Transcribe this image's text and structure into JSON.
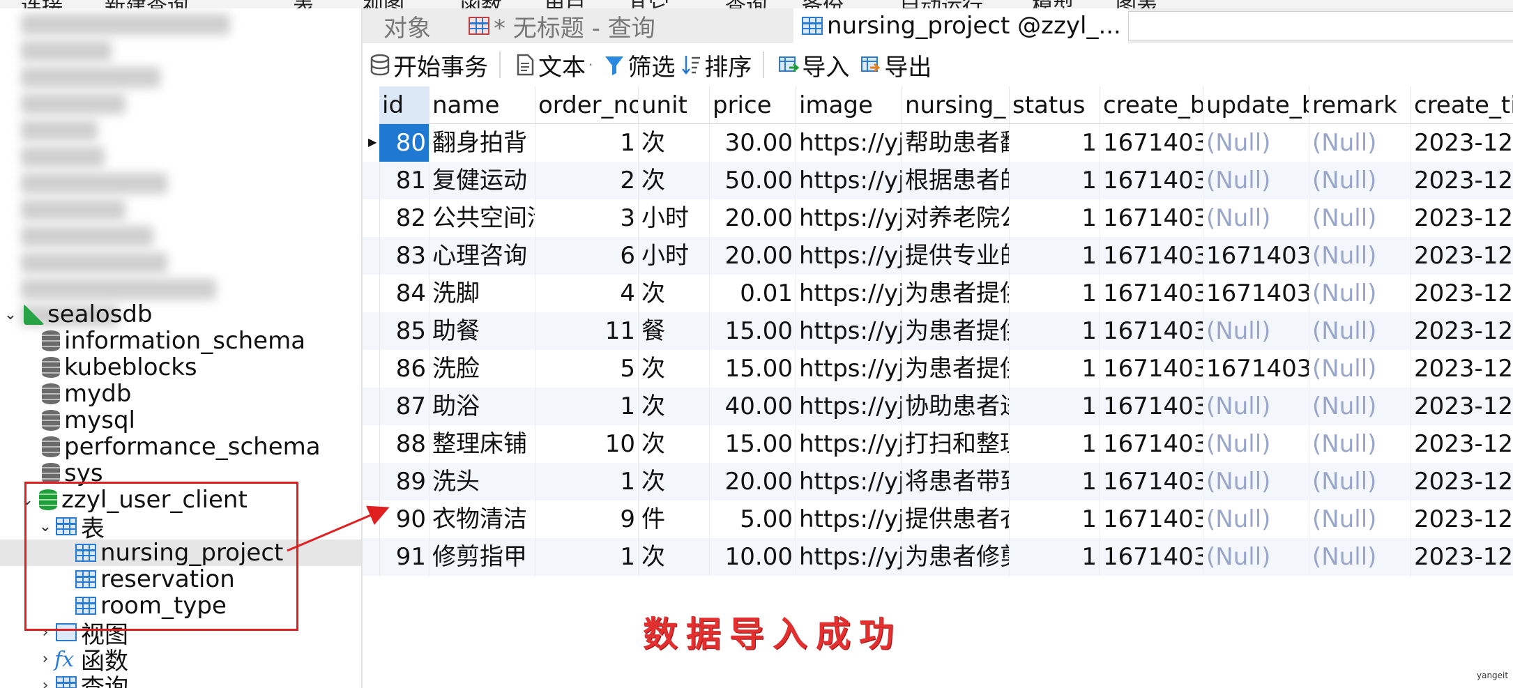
{
  "menubar": {
    "items": [
      "连接",
      "新建查询",
      "表",
      "视图",
      "函数",
      "用户",
      "其它",
      "查询",
      "备份",
      "自动运行",
      "模型",
      "图表"
    ]
  },
  "navigator": {
    "connection": {
      "name": "sealosdb",
      "expanded": true
    },
    "databases": [
      {
        "name": "information_schema"
      },
      {
        "name": "kubeblocks"
      },
      {
        "name": "mydb"
      },
      {
        "name": "mysql"
      },
      {
        "name": "performance_schema"
      },
      {
        "name": "sys"
      }
    ],
    "active_database": {
      "name": "zzyl_user_client",
      "tables_folder": "表",
      "tables": [
        "nursing_project",
        "reservation",
        "room_type"
      ],
      "selected_table": "nursing_project",
      "views_folder": "视图",
      "functions_folder": "函数",
      "queries_folder": "查询"
    }
  },
  "tabs": [
    {
      "label": "对象",
      "active": false
    },
    {
      "label": "* 无标题 - 查询",
      "active": false
    },
    {
      "label": "nursing_project @zzyl_...",
      "active": true
    }
  ],
  "toolbar": {
    "begin_transaction": "开始事务",
    "text": "文本",
    "filter": "筛选",
    "sort": "排序",
    "import": "导入",
    "export": "导出"
  },
  "grid": {
    "columns": [
      "id",
      "name",
      "order_no",
      "unit",
      "price",
      "image",
      "nursing_",
      "status",
      "create_by",
      "update_by",
      "remark",
      "create_ti"
    ],
    "rows": [
      [
        "80",
        "翻身拍背",
        "1",
        "次",
        "30.00",
        "https://yj",
        "帮助患者翻",
        "1",
        "1671403",
        "(Null)",
        "(Null)",
        "2023-12"
      ],
      [
        "81",
        "复健运动",
        "2",
        "次",
        "50.00",
        "https://yj",
        "根据患者的",
        "1",
        "1671403",
        "(Null)",
        "(Null)",
        "2023-12"
      ],
      [
        "82",
        "公共空间清",
        "3",
        "小时",
        "20.00",
        "https://yj",
        "对养老院公",
        "1",
        "1671403",
        "(Null)",
        "(Null)",
        "2023-12"
      ],
      [
        "83",
        "心理咨询",
        "6",
        "小时",
        "20.00",
        "https://yj",
        "提供专业的",
        "1",
        "1671403",
        "1671403",
        "(Null)",
        "2023-12"
      ],
      [
        "84",
        "洗脚",
        "4",
        "次",
        "0.01",
        "https://yj",
        "为患者提供",
        "1",
        "1671403",
        "1671403",
        "(Null)",
        "2023-12"
      ],
      [
        "85",
        "助餐",
        "11",
        "餐",
        "15.00",
        "https://yj",
        "为患者提供",
        "1",
        "1671403",
        "(Null)",
        "(Null)",
        "2023-12"
      ],
      [
        "86",
        "洗脸",
        "5",
        "次",
        "15.00",
        "https://yj",
        "为患者提供",
        "1",
        "1671403",
        "1671403",
        "(Null)",
        "2023-12"
      ],
      [
        "87",
        "助浴",
        "1",
        "次",
        "40.00",
        "https://yj",
        "协助患者进",
        "1",
        "1671403",
        "(Null)",
        "(Null)",
        "2023-12"
      ],
      [
        "88",
        "整理床铺",
        "10",
        "次",
        "15.00",
        "https://yj",
        "打扫和整理",
        "1",
        "1671403",
        "(Null)",
        "(Null)",
        "2023-12"
      ],
      [
        "89",
        "洗头",
        "1",
        "次",
        "20.00",
        "https://yj",
        "将患者带到",
        "1",
        "1671403",
        "(Null)",
        "(Null)",
        "2023-12"
      ],
      [
        "90",
        "衣物清洁",
        "9",
        "件",
        "5.00",
        "https://yj",
        "提供患者衣",
        "1",
        "1671403",
        "(Null)",
        "(Null)",
        "2023-12"
      ],
      [
        "91",
        "修剪指甲",
        "1",
        "次",
        "10.00",
        "https://yj",
        "为患者修剪",
        "1",
        "1671403",
        "(Null)",
        "(Null)",
        "2023-12"
      ]
    ],
    "selected_row": 0
  },
  "annotation": {
    "caption": "数据导入成功",
    "color": "#e02020"
  },
  "watermark": "yangeit"
}
